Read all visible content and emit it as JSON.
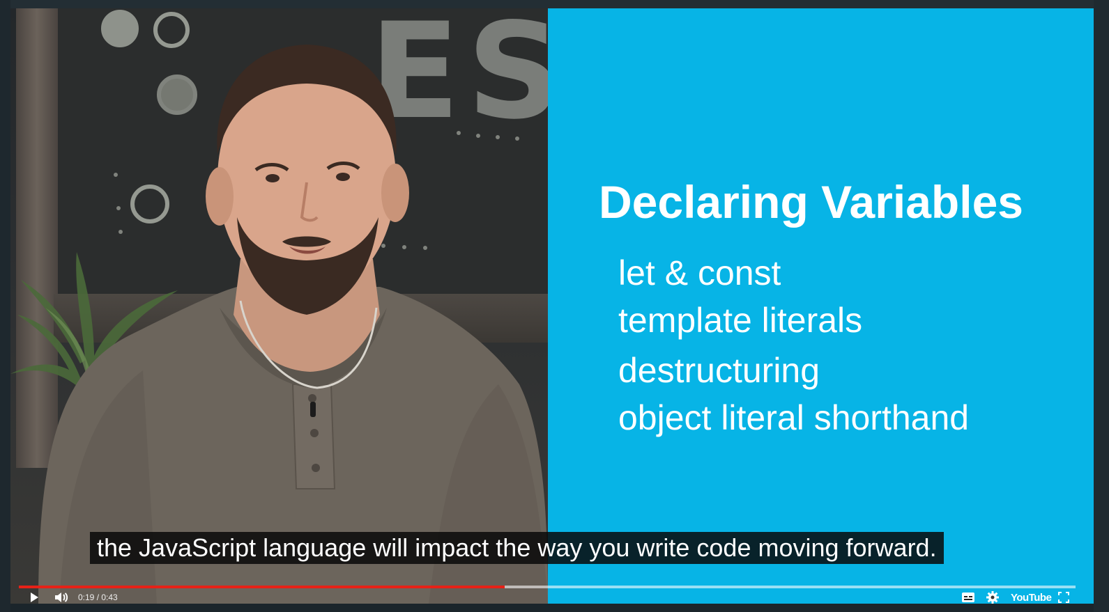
{
  "video": {
    "slide": {
      "title": "Declaring Variables",
      "items": [
        "let & const",
        "template literals",
        "destructuring",
        "object literal shorthand"
      ],
      "background_color": "#07b4e6"
    },
    "chalkboard_text": "ES",
    "caption": "the JavaScript language will impact the way you write code moving forward."
  },
  "player": {
    "current_time": "0:19",
    "separator": " / ",
    "duration": "0:43",
    "progress_fraction": 0.46,
    "loaded_fraction": 1.0,
    "progress_color": "#e62117",
    "logo_text": "YouTube",
    "icons": [
      "play-icon",
      "volume-icon",
      "captions-icon",
      "settings-icon",
      "fullscreen-icon"
    ]
  }
}
